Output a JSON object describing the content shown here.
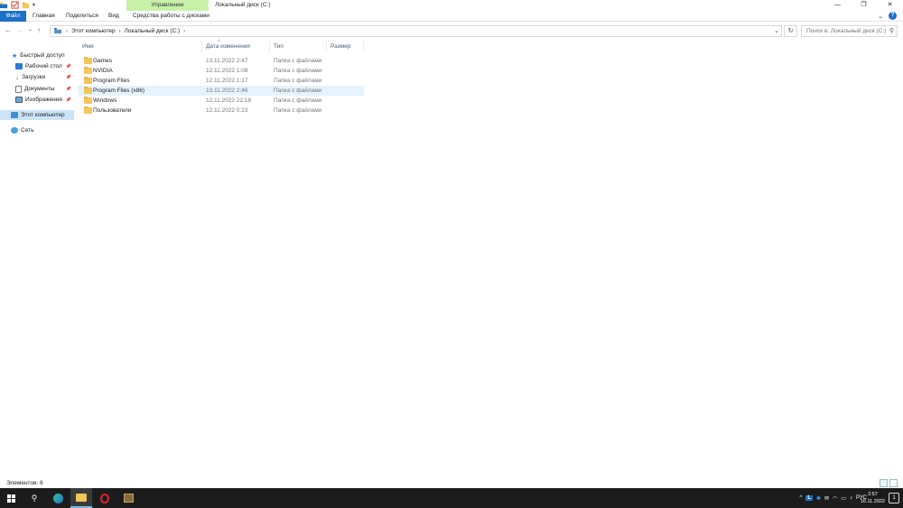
{
  "window": {
    "title": "Локальный диск (C:)",
    "contextual_tab": "Управление",
    "controls": {
      "minimize": "—",
      "restore": "❐",
      "close": "✕"
    }
  },
  "ribbon": {
    "tabs": [
      {
        "label": "Файл"
      },
      {
        "label": "Главная"
      },
      {
        "label": "Поделиться"
      },
      {
        "label": "Вид"
      },
      {
        "label": "Средства работы с дисками"
      }
    ],
    "help": "?"
  },
  "address": {
    "crumbs": [
      "Этот компьютер",
      "Локальный диск (C:)"
    ],
    "search_placeholder": "Поиск в: Локальный диск (C:)"
  },
  "navpane": {
    "items": [
      {
        "label": "Быстрый доступ",
        "icon": "star-icon",
        "pinned": false
      },
      {
        "label": "Рабочий стол",
        "icon": "desktop-icon",
        "pinned": true
      },
      {
        "label": "Загрузки",
        "icon": "download-icon",
        "pinned": true
      },
      {
        "label": "Документы",
        "icon": "documents-icon",
        "pinned": true
      },
      {
        "label": "Изображения",
        "icon": "pictures-icon",
        "pinned": true
      },
      {
        "label": "Этот компьютер",
        "icon": "computer-icon",
        "pinned": false
      },
      {
        "label": "Сеть",
        "icon": "network-icon",
        "pinned": false
      }
    ]
  },
  "columns": [
    "Имя",
    "Дата изменения",
    "Тип",
    "Размер"
  ],
  "files": [
    {
      "name": "Games",
      "date": "13.11.2022 2:47",
      "type": "Папка с файлами",
      "size": ""
    },
    {
      "name": "NVIDIA",
      "date": "12.11.2022 1:08",
      "type": "Папка с файлами",
      "size": ""
    },
    {
      "name": "Program Files",
      "date": "12.11.2022 1:17",
      "type": "Папка с файлами",
      "size": ""
    },
    {
      "name": "Program Files (x86)",
      "date": "13.11.2022 2:46",
      "type": "Папка с файлами",
      "size": ""
    },
    {
      "name": "Windows",
      "date": "12.11.2022 22:18",
      "type": "Папка с файлами",
      "size": ""
    },
    {
      "name": "Пользователи",
      "date": "12.11.2022 0:23",
      "type": "Папка с файлами",
      "size": ""
    }
  ],
  "selected_row": 3,
  "status": {
    "count": "Элементов: 6"
  },
  "taskbar": {
    "lang": "РУС",
    "time": "2:57",
    "date": "16.11.2022",
    "notif_count": "1",
    "accent": "#76b9ed"
  }
}
